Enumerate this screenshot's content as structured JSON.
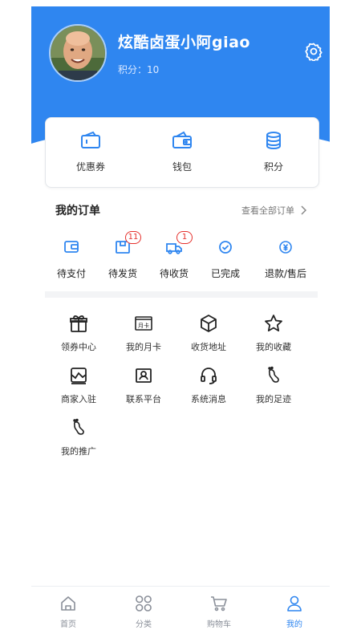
{
  "profile": {
    "username": "炫酷卤蛋小阿giao",
    "points_label": "积分：10"
  },
  "wallet": {
    "items": [
      {
        "label": "优惠券",
        "icon": "coupon-icon"
      },
      {
        "label": "钱包",
        "icon": "wallet-icon"
      },
      {
        "label": "积分",
        "icon": "points-stack-icon"
      }
    ]
  },
  "orders": {
    "title": "我的订单",
    "view_all": "查看全部订单",
    "items": [
      {
        "label": "待支付",
        "icon": "pending-payment-icon",
        "badge": ""
      },
      {
        "label": "待发货",
        "icon": "to-ship-icon",
        "badge": "11"
      },
      {
        "label": "待收货",
        "icon": "to-receive-icon",
        "badge": "1"
      },
      {
        "label": "已完成",
        "icon": "completed-icon",
        "badge": ""
      },
      {
        "label": "退款/售后",
        "icon": "refund-icon",
        "badge": ""
      }
    ]
  },
  "services": {
    "items": [
      {
        "label": "领券中心",
        "icon": "gift-icon"
      },
      {
        "label": "我的月卡",
        "icon": "monthly-card-icon",
        "card_text": "月卡"
      },
      {
        "label": "收货地址",
        "icon": "box-icon"
      },
      {
        "label": "我的收藏",
        "icon": "star-icon"
      },
      {
        "label": "商家入驻",
        "icon": "merchant-icon"
      },
      {
        "label": "联系平台",
        "icon": "contact-card-icon"
      },
      {
        "label": "系统消息",
        "icon": "headset-icon"
      },
      {
        "label": "我的足迹",
        "icon": "footprint-icon"
      },
      {
        "label": "我的推广",
        "icon": "promotion-icon"
      }
    ]
  },
  "tabbar": {
    "items": [
      {
        "label": "首页",
        "icon": "home-icon",
        "active": false
      },
      {
        "label": "分类",
        "icon": "category-icon",
        "active": false
      },
      {
        "label": "购物车",
        "icon": "cart-icon",
        "active": false
      },
      {
        "label": "我的",
        "icon": "user-icon",
        "active": true
      }
    ]
  },
  "colors": {
    "brand_blue": "#2f86f0",
    "badge_red": "#e5302c",
    "icon_blue": "#2f86f0"
  }
}
